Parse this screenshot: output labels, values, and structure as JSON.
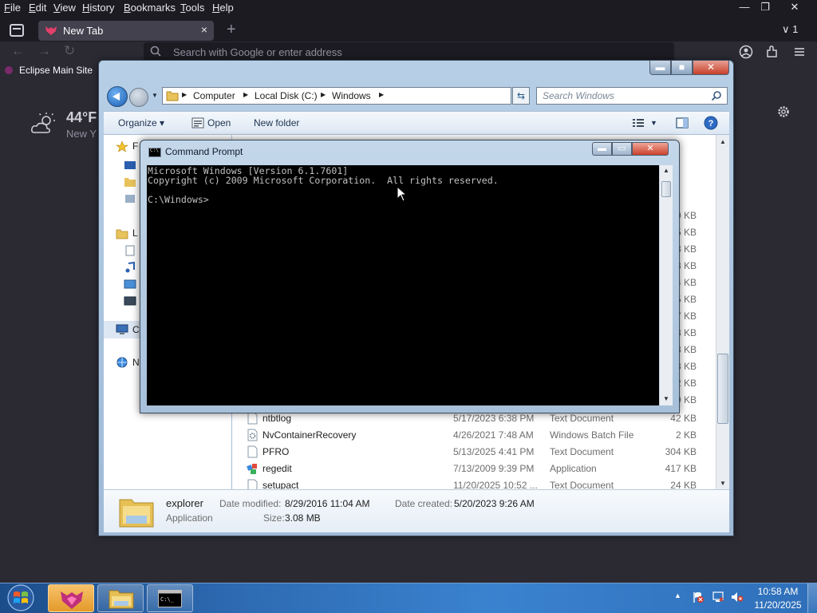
{
  "browser": {
    "menus": [
      "File",
      "Edit",
      "View",
      "History",
      "Bookmarks",
      "Tools",
      "Help"
    ],
    "menu_access_keys": [
      "F",
      "E",
      "V",
      "H",
      "B",
      "T",
      "H"
    ],
    "tab": {
      "title": "New Tab",
      "close": "×"
    },
    "new_tab": "+",
    "tab_overflow": "∨ 1",
    "url_placeholder": "Search with Google or enter address",
    "bookmark": "Eclipse Main Site",
    "weather": {
      "temp": "44°F",
      "location": "New Y"
    },
    "window_controls": {
      "minimize": "—",
      "restore": "❐",
      "close": "✕"
    }
  },
  "explorer": {
    "controls": {
      "minimize": "▬",
      "maximize": "■",
      "close": "✕"
    },
    "breadcrumb": [
      "Computer",
      "Local Disk (C:)",
      "Windows"
    ],
    "search_placeholder": "Search Windows",
    "toolbar": {
      "organize": "Organize",
      "open": "Open",
      "new_folder": "New folder"
    },
    "nav_items": [
      "F",
      "L",
      "C",
      "N"
    ],
    "visible_sizes": [
      "0 KB",
      "5 KB",
      "3 KB",
      "3 KB",
      "4 KB",
      "5 KB",
      "7 KB",
      "3 KB",
      "3 KB",
      "3 KB",
      "2 KB",
      "9 KB"
    ],
    "files": [
      {
        "name": "ntbtlog",
        "date": "5/17/2023 6:38 PM",
        "type": "Text Document",
        "size": "42 KB",
        "icon": "text-file-icon"
      },
      {
        "name": "NvContainerRecovery",
        "date": "4/26/2021 7:48 AM",
        "type": "Windows Batch File",
        "size": "2 KB",
        "icon": "batch-file-icon"
      },
      {
        "name": "PFRO",
        "date": "5/13/2025 4:41 PM",
        "type": "Text Document",
        "size": "304 KB",
        "icon": "text-file-icon"
      },
      {
        "name": "regedit",
        "date": "7/13/2009 9:39 PM",
        "type": "Application",
        "size": "417 KB",
        "icon": "regedit-icon"
      },
      {
        "name": "setupact",
        "date": "11/20/2025 10:52 ...",
        "type": "Text Document",
        "size": "24 KB",
        "icon": "text-file-icon"
      }
    ],
    "details": {
      "name": "explorer",
      "kind": "Application",
      "modified_label": "Date modified:",
      "modified": "8/29/2016 11:04 AM",
      "created_label": "Date created:",
      "created": "5/20/2023 9:26 AM",
      "size_label": "Size:",
      "size": "3.08 MB"
    }
  },
  "cmd": {
    "title": "Command Prompt",
    "controls": {
      "minimize": "▬",
      "maximize": "▭",
      "close": "✕"
    },
    "lines": [
      "Microsoft Windows [Version 6.1.7601]",
      "Copyright (c) 2009 Microsoft Corporation.  All rights reserved.",
      "",
      "C:\\Windows>"
    ]
  },
  "taskbar": {
    "time": "10:58 AM",
    "date": "11/20/2025",
    "tray_overflow": "▲"
  },
  "colors": {
    "browser_bg": "#1c1b22",
    "browser_toolbar": "#2b2a33",
    "console_bg": "#000000",
    "console_text": "#c0c0c0",
    "taskbar": "#2e6bb3",
    "close_red": "#c7402a"
  }
}
